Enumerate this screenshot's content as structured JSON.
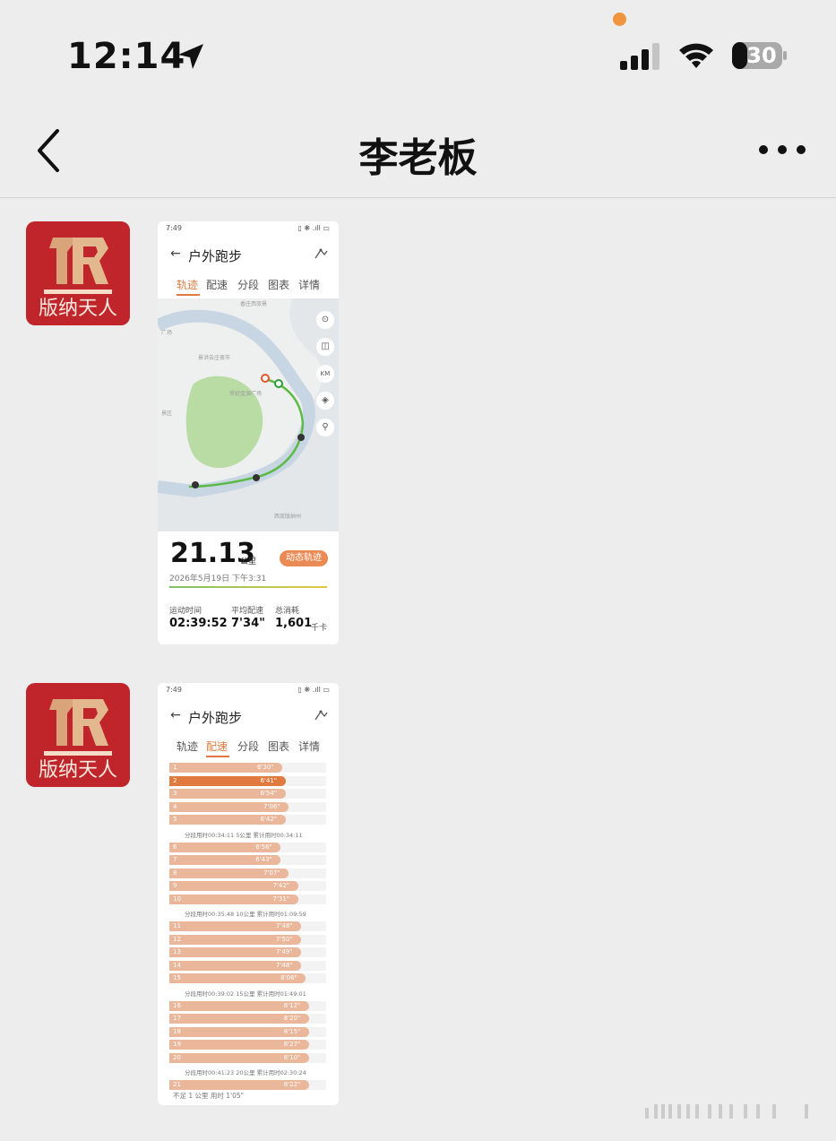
{
  "status_bar": {
    "time": "12:14",
    "battery": "30"
  },
  "nav": {
    "title": "李老板"
  },
  "avatar": {
    "text_main": "版纳天人"
  },
  "screenshot1": {
    "status_time": "7:49",
    "status_right": "▯ ❋ .ıll ▭",
    "back": "←",
    "title": "户外跑步",
    "tabs": [
      "轨迹",
      "配速",
      "分段",
      "图表",
      "详情"
    ],
    "active_tab": "轨迹",
    "distance": "21.13",
    "distance_unit": "公里",
    "date": "2026年5月19日 下午3:31",
    "dynamic_button": "动态轨迹",
    "stats": [
      {
        "label": "运动时间",
        "value": "02:39:52"
      },
      {
        "label": "平均配速",
        "value": "7'34\""
      },
      {
        "label": "总消耗",
        "value": "1,601",
        "unit": "千卡"
      }
    ],
    "map_controls": [
      "⊙",
      "◫",
      "KM",
      "◈",
      "⚲"
    ]
  },
  "screenshot2": {
    "status_time": "7:49",
    "status_right": "▯ ❋ .ıll ▭",
    "back": "←",
    "title": "户外跑步",
    "tabs": [
      "轨迹",
      "配速",
      "分段",
      "图表",
      "详情"
    ],
    "active_tab": "配速",
    "paces": [
      {
        "km": "1",
        "pace": "6'30\"",
        "fraction": 0.72
      },
      {
        "km": "2",
        "pace": "6'41\"",
        "fraction": 0.74,
        "fastest": true
      },
      {
        "km": "3",
        "pace": "6'54\"",
        "fraction": 0.74
      },
      {
        "km": "4",
        "pace": "7'06\"",
        "fraction": 0.76
      },
      {
        "km": "5",
        "pace": "6'42\"",
        "fraction": 0.74
      },
      {
        "km": "6",
        "pace": "6'56\"",
        "fraction": 0.71
      },
      {
        "km": "7",
        "pace": "6'43\"",
        "fraction": 0.71
      },
      {
        "km": "8",
        "pace": "7'07\"",
        "fraction": 0.76
      },
      {
        "km": "9",
        "pace": "7'42\"",
        "fraction": 0.82
      },
      {
        "km": "10",
        "pace": "7'31\"",
        "fraction": 0.82
      },
      {
        "km": "11",
        "pace": "7'48\"",
        "fraction": 0.84
      },
      {
        "km": "12",
        "pace": "7'50\"",
        "fraction": 0.84
      },
      {
        "km": "13",
        "pace": "7'49\"",
        "fraction": 0.84
      },
      {
        "km": "14",
        "pace": "7'48\"",
        "fraction": 0.84
      },
      {
        "km": "15",
        "pace": "8'06\"",
        "fraction": 0.87
      },
      {
        "km": "16",
        "pace": "8'12\"",
        "fraction": 0.89
      },
      {
        "km": "17",
        "pace": "8'20\"",
        "fraction": 0.89
      },
      {
        "km": "18",
        "pace": "8'15\"",
        "fraction": 0.89
      },
      {
        "km": "19",
        "pace": "8'27\"",
        "fraction": 0.89
      },
      {
        "km": "20",
        "pace": "8'10\"",
        "fraction": 0.89
      },
      {
        "km": "21",
        "pace": "8'22\"",
        "fraction": 0.89
      }
    ],
    "split_notes": [
      "分段用时00:34:11      5公里 累计用时00:34:11",
      "分段用时00:35:48      10公里 累计用时01:09:59",
      "分段用时00:39:02      15公里 累计用时01:49:01",
      "分段用时00:41:23      20公里 累计用时02:30:24"
    ],
    "footer": "不足 1 公里 用时 1'05\""
  }
}
